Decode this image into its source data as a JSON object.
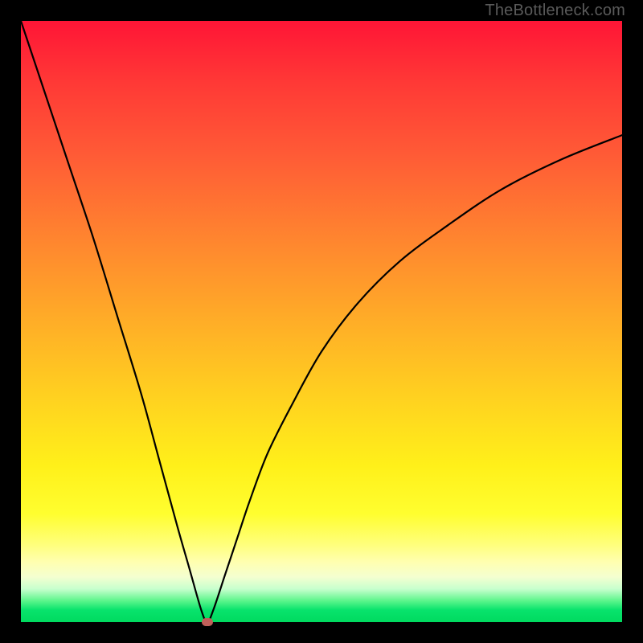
{
  "watermark": "TheBottleneck.com",
  "chart_data": {
    "type": "line",
    "title": "",
    "xlabel": "",
    "ylabel": "",
    "xlim": [
      0,
      100
    ],
    "ylim": [
      0,
      100
    ],
    "background_gradient": {
      "orientation": "vertical",
      "stops": [
        {
          "pct": 0,
          "color": "#ff1536",
          "meaning": "high-bottleneck"
        },
        {
          "pct": 50,
          "color": "#ffb326"
        },
        {
          "pct": 80,
          "color": "#fff01a"
        },
        {
          "pct": 92,
          "color": "#f4ffd0"
        },
        {
          "pct": 100,
          "color": "#00da5f",
          "meaning": "no-bottleneck"
        }
      ]
    },
    "series": [
      {
        "name": "bottleneck-curve",
        "x": [
          0,
          4,
          8,
          12,
          16,
          20,
          23,
          26,
          28,
          30,
          31,
          32,
          34,
          36,
          38,
          41,
          45,
          50,
          56,
          63,
          71,
          80,
          90,
          100
        ],
        "y": [
          100,
          88,
          76,
          64,
          51,
          38,
          27,
          16,
          9,
          2,
          0,
          2,
          8,
          14,
          20,
          28,
          36,
          45,
          53,
          60,
          66,
          72,
          77,
          81
        ]
      }
    ],
    "minimum_point": {
      "x": 31,
      "y": 0
    },
    "annotations": []
  }
}
